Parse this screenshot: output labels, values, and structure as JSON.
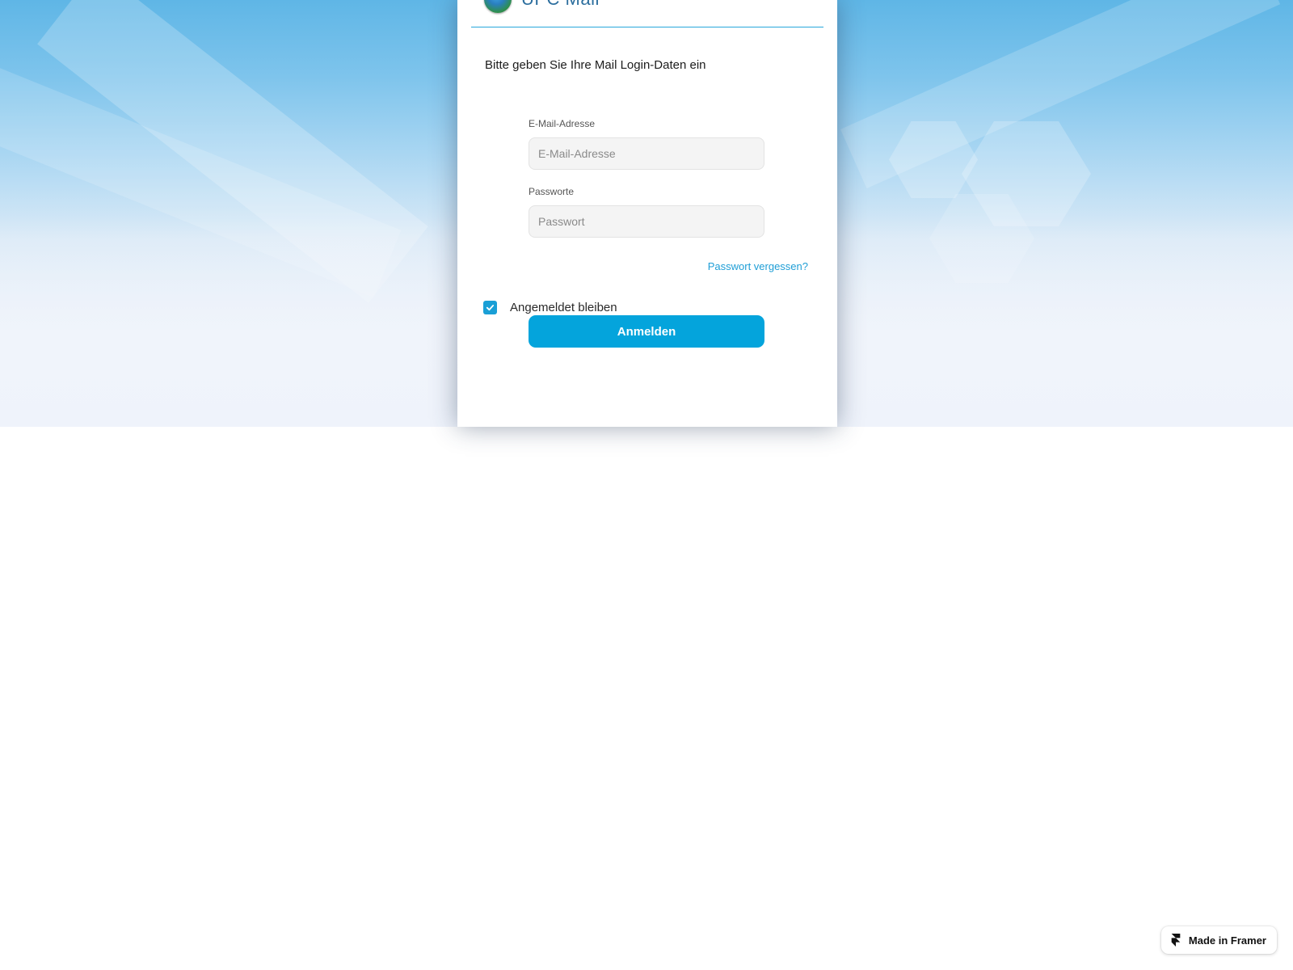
{
  "brand": {
    "name": "UPC Mail",
    "logo_icon": "globe-logo-icon"
  },
  "login": {
    "intro": "Bitte geben Sie Ihre Mail Login-Daten ein",
    "email_label": "E-Mail-Adresse",
    "email_placeholder": "E-Mail-Adresse",
    "email_value": "",
    "password_label": "Passworte",
    "password_placeholder": "Passwort",
    "password_value": "",
    "forgot_link": "Passwort vergessen?",
    "remember_label": "Angemeldet bleiben",
    "remember_checked": true,
    "submit_label": "Anmelden"
  },
  "badge": {
    "label": "Made in Framer",
    "icon": "framer-logo-icon"
  },
  "colors": {
    "accent": "#04a4dc",
    "link": "#1f9ed6",
    "brand_text": "#2c6e9e"
  }
}
